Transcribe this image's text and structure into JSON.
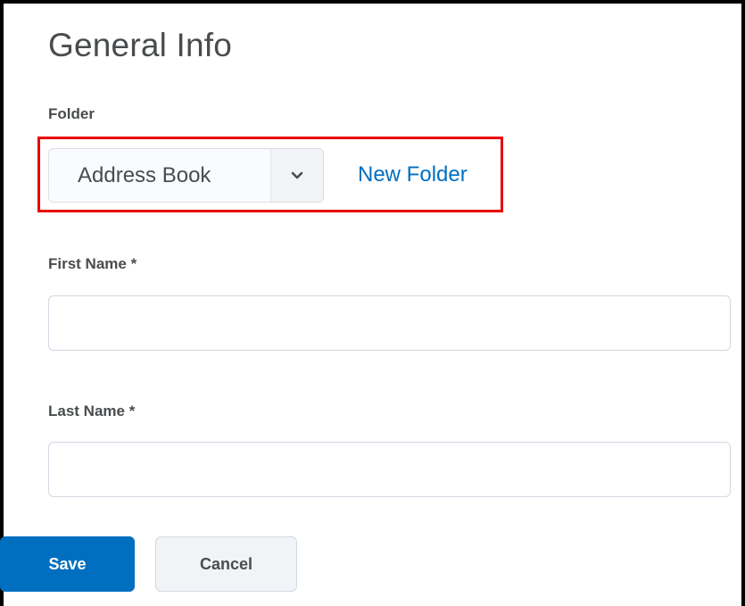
{
  "form": {
    "title": "General Info",
    "folder": {
      "label": "Folder",
      "selected": "Address Book",
      "new_folder_link": "New Folder"
    },
    "first_name": {
      "label": "First Name *",
      "value": ""
    },
    "last_name": {
      "label": "Last Name *",
      "value": ""
    }
  },
  "actions": {
    "save_label": "Save",
    "cancel_label": "Cancel"
  },
  "colors": {
    "accent": "#006fbf",
    "highlight": "#e8000b",
    "text": "#494c4e"
  },
  "icons": {
    "dropdown": "chevron-down-icon"
  }
}
